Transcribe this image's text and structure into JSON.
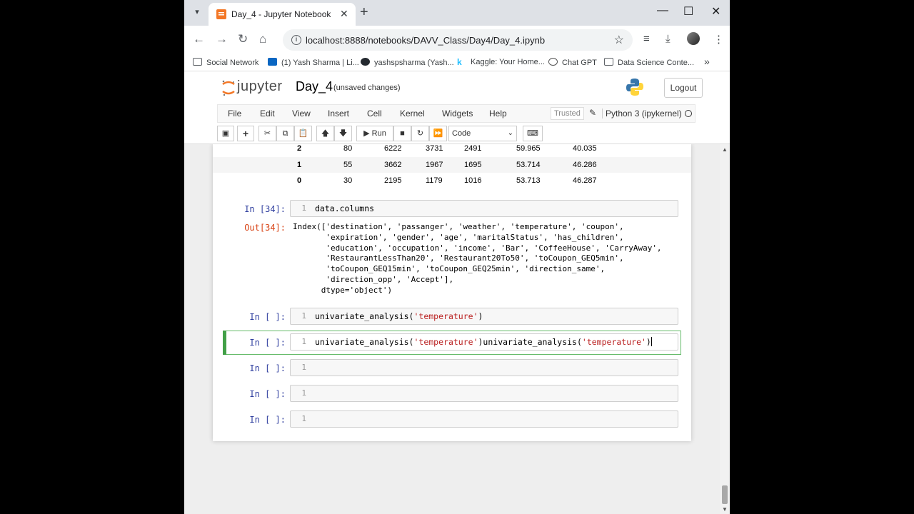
{
  "browser": {
    "tab_title": "Day_4 - Jupyter Notebook",
    "url": "localhost:8888/notebooks/DAVV_Class/Day4/Day_4.ipynb",
    "bookmarks": [
      {
        "label": "Social Network",
        "icon": "folder-icon"
      },
      {
        "label": "(1) Yash Sharma | Li...",
        "icon": "linkedin-icon"
      },
      {
        "label": "yashspsharma (Yash...",
        "icon": "github-icon"
      },
      {
        "label": "Kaggle: Your Home...",
        "icon": "kaggle-icon"
      },
      {
        "label": "Chat GPT",
        "icon": "chatgpt-icon"
      },
      {
        "label": "Data Science Conte...",
        "icon": "folder-icon"
      }
    ],
    "more_bookmarks": "»"
  },
  "jupyter": {
    "logo_text": "jupyter",
    "notebook_name": "Day_4",
    "save_status": "(unsaved changes)",
    "logout": "Logout",
    "menu": [
      "File",
      "Edit",
      "View",
      "Insert",
      "Cell",
      "Kernel",
      "Widgets",
      "Help"
    ],
    "trusted": "Trusted",
    "kernel_name": "Python 3 (ipykernel)",
    "run_label": "Run",
    "cell_type": "Code"
  },
  "dataframe_rows": [
    {
      "index": "2",
      "c1": "80",
      "c2": "6222",
      "c3": "3731",
      "c4": "2491",
      "c5": "59.965",
      "c6": "40.035"
    },
    {
      "index": "1",
      "c1": "55",
      "c2": "3662",
      "c3": "1967",
      "c4": "1695",
      "c5": "53.714",
      "c6": "46.286"
    },
    {
      "index": "0",
      "c1": "30",
      "c2": "2195",
      "c3": "1179",
      "c4": "1016",
      "c5": "53.713",
      "c6": "46.287"
    }
  ],
  "cells": {
    "c34_prompt": "In [34]:",
    "c34_code": "data.columns",
    "c34_out_prompt": "Out[34]:",
    "c34_output": "Index(['destination', 'passanger', 'weather', 'temperature', 'coupon',\n       'expiration', 'gender', 'age', 'maritalStatus', 'has_children',\n       'education', 'occupation', 'income', 'Bar', 'CoffeeHouse', 'CarryAway',\n       'RestaurantLessThan20', 'Restaurant20To50', 'toCoupon_GEQ5min',\n       'toCoupon_GEQ15min', 'toCoupon_GEQ25min', 'direction_same',\n       'direction_opp', 'Accept'],\n      dtype='object')",
    "empty_prompt": "In [ ]:",
    "line_number": "1",
    "cell_a_fn": "univariate_analysis(",
    "cell_a_str": "'temperature'",
    "cell_a_end": ")",
    "cell_b_fn1": "univariate_analysis(",
    "cell_b_str1": "'temperature'",
    "cell_b_mid": ")univariate_analysis(",
    "cell_b_str2": "'temperature'",
    "cell_b_end": ")"
  }
}
